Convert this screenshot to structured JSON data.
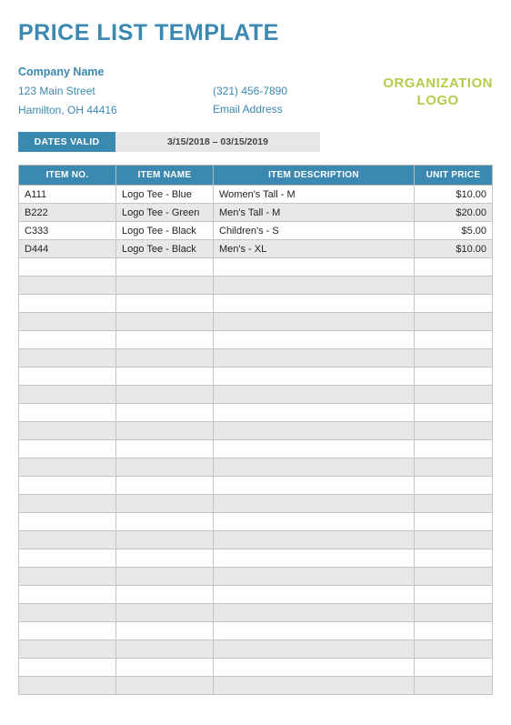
{
  "title": "PRICE LIST TEMPLATE",
  "company": {
    "name": "Company Name",
    "street": "123 Main Street",
    "city_line": "Hamilton, OH 44416"
  },
  "contact": {
    "phone": "(321) 456-7890",
    "email": "Email Address"
  },
  "logo": {
    "line1": "ORGANIZATION",
    "line2": "LOGO"
  },
  "dates": {
    "label": "DATES VALID",
    "value": "3/15/2018 – 03/15/2019"
  },
  "columns": {
    "item_no": "ITEM NO.",
    "item_name": "ITEM NAME",
    "item_desc": "ITEM DESCRIPTION",
    "unit_price": "UNIT PRICE"
  },
  "rows": [
    {
      "no": "A111",
      "name": "Logo Tee - Blue",
      "desc": "Women's Tall - M",
      "price": "$10.00"
    },
    {
      "no": "B222",
      "name": "Logo Tee - Green",
      "desc": "Men's Tall - M",
      "price": "$20.00"
    },
    {
      "no": "C333",
      "name": "Logo Tee - Black",
      "desc": "Children's - S",
      "price": "$5.00"
    },
    {
      "no": "D444",
      "name": "Logo Tee - Black",
      "desc": "Men's - XL",
      "price": "$10.00"
    }
  ],
  "empty_rows": 24
}
